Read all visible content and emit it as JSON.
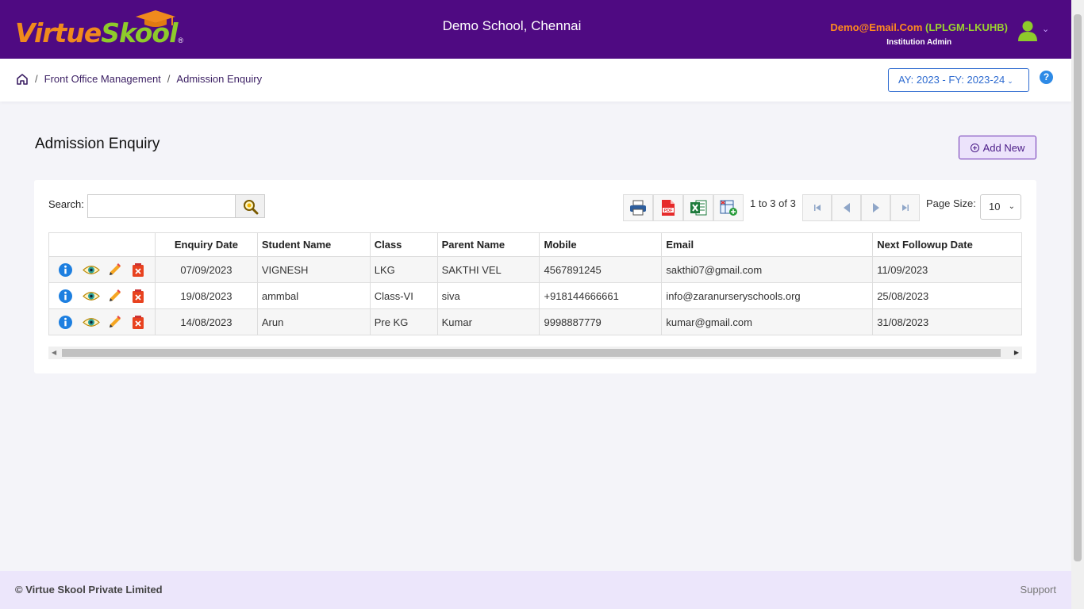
{
  "header": {
    "logo_part1": "Virtue",
    "logo_part2": "Skool",
    "logo_reg": "®",
    "school_name": "Demo School, Chennai",
    "user_email": "Demo@Email.Com",
    "user_code": "(LPLGM-LKUHB)",
    "user_role": "Institution Admin",
    "caret": "⌄"
  },
  "breadcrumb": {
    "items": [
      "Front Office Management",
      "Admission Enquiry"
    ],
    "separator": "/"
  },
  "academic_year": {
    "label": "AY: 2023 - FY: 2023-24",
    "chevron": "⌄"
  },
  "help": {
    "label": "?"
  },
  "page": {
    "title": "Admission Enquiry",
    "add_new": "Add New"
  },
  "toolbar": {
    "search_label": "Search:",
    "search_value": "",
    "search_placeholder": "",
    "pager_info": "1 to 3 of 3",
    "page_size_label": "Page Size:",
    "page_size_value": "10",
    "page_size_chevron": "⌄"
  },
  "table": {
    "columns": [
      "",
      "Enquiry Date",
      "Student Name",
      "Class",
      "Parent Name",
      "Mobile",
      "Email",
      "Next Followup Date"
    ],
    "rows": [
      {
        "date": "07/09/2023",
        "student": "VIGNESH",
        "class": "LKG",
        "parent": "SAKTHI VEL",
        "mobile": "4567891245",
        "email": "sakthi07@gmail.com",
        "followup": "11/09/2023"
      },
      {
        "date": "19/08/2023",
        "student": "ammbal",
        "class": "Class-VI",
        "parent": "siva",
        "mobile": "+918144666661",
        "email": "info@zaranurseryschools.org",
        "followup": "25/08/2023"
      },
      {
        "date": "14/08/2023",
        "student": "Arun",
        "class": "Pre KG",
        "parent": "Kumar",
        "mobile": "9998887779",
        "email": "kumar@gmail.com",
        "followup": "31/08/2023"
      }
    ]
  },
  "footer": {
    "copyright": "© Virtue Skool Private Limited",
    "support": "Support"
  },
  "colors": {
    "header_bg": "#4f0a82",
    "logo_orange": "#f08a1d",
    "logo_green": "#8ecb2b",
    "link_blue": "#2e6bd0",
    "footer_bg": "#ece6fb"
  },
  "icons": [
    "home-icon",
    "help-icon",
    "avatar-icon",
    "search-icon",
    "print-icon",
    "pdf-icon",
    "excel-icon",
    "export-columns-icon",
    "first-page-icon",
    "prev-page-icon",
    "next-page-icon",
    "last-page-icon",
    "info-icon",
    "view-icon",
    "edit-icon",
    "delete-icon"
  ]
}
